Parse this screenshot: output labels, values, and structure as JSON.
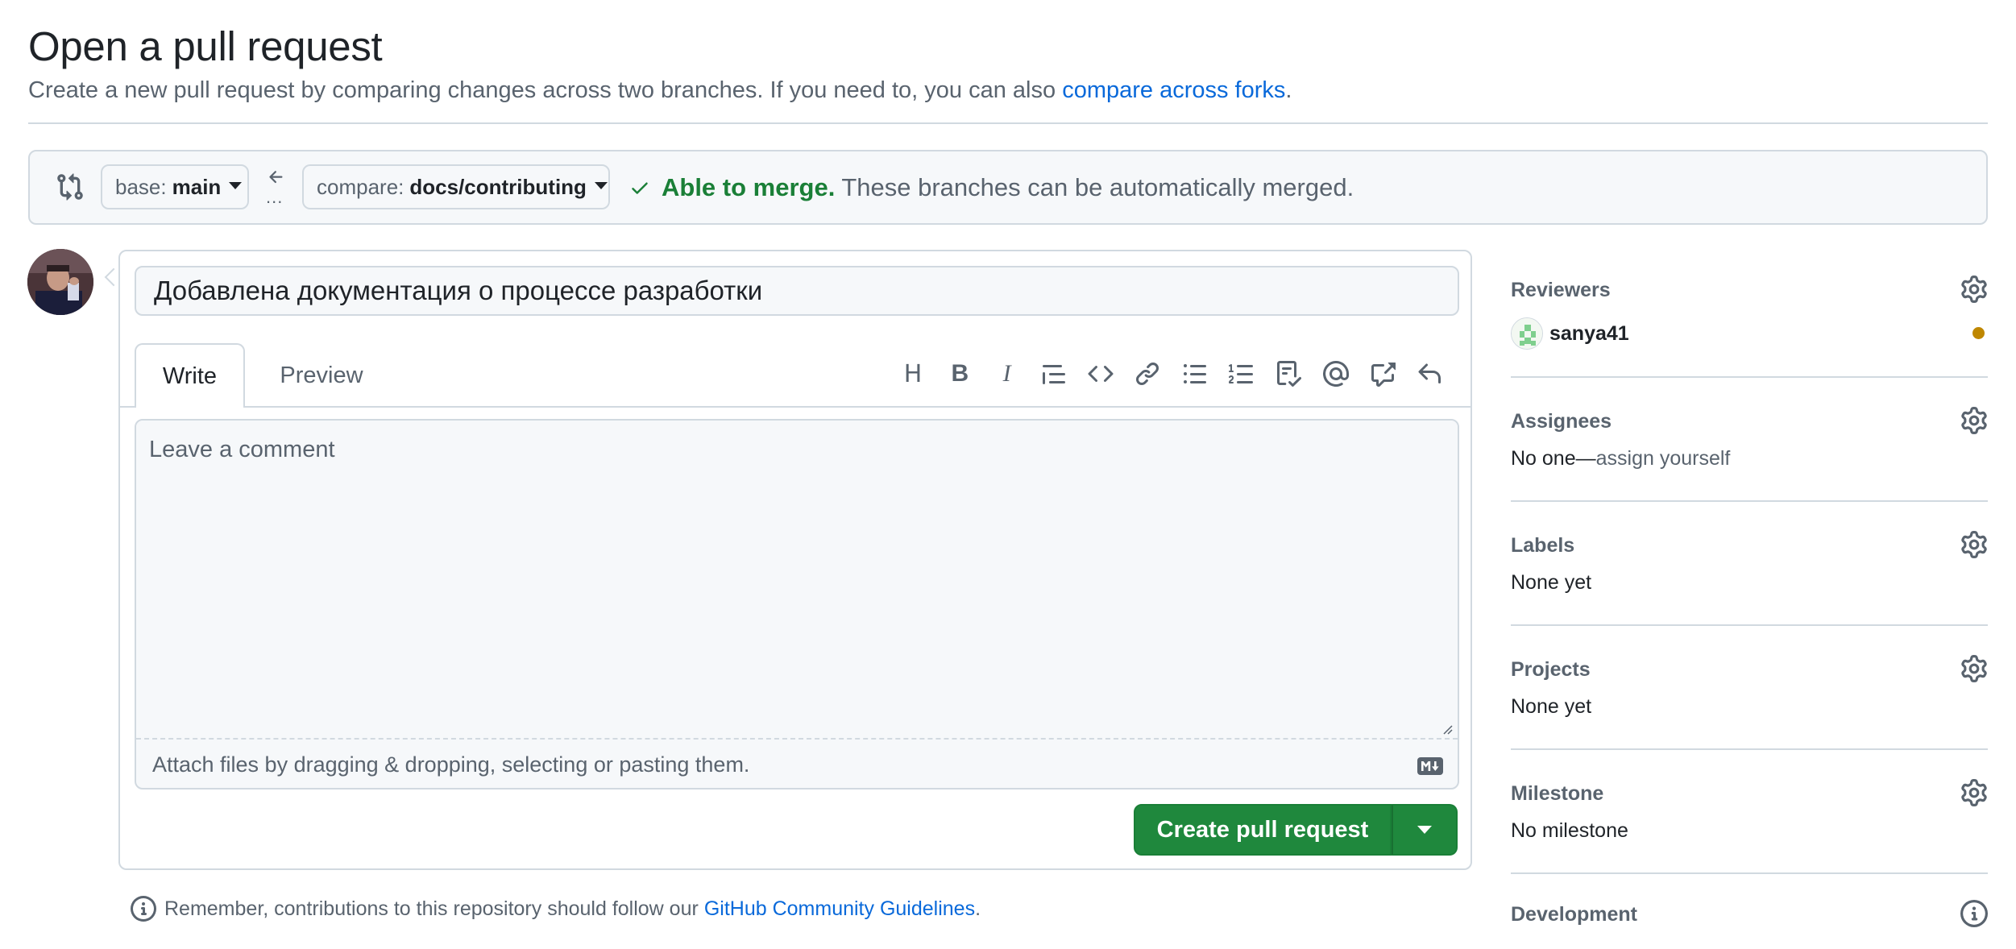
{
  "header": {
    "title": "Open a pull request",
    "subtitle": "Create a new pull request by comparing changes across two branches. If you need to, you can also",
    "subtitle_link": "compare across forks",
    "subtitle_end": "."
  },
  "range": {
    "base_label": "base:",
    "base_branch": "main",
    "arrow_dots": "...",
    "compare_label": "compare:",
    "compare_branch": "docs/contributing",
    "merge_ok": "Able to merge.",
    "merge_text": "These branches can be automatically merged."
  },
  "composer": {
    "title_value": "Добавлена документация о процессе разработки",
    "tabs": {
      "write": "Write",
      "preview": "Preview"
    },
    "toolbar": {
      "heading": "H",
      "bold": "B",
      "italic": "I"
    },
    "comment_placeholder": "Leave a comment",
    "attach_text": "Attach files by dragging & dropping, selecting or pasting them.",
    "create_label": "Create pull request"
  },
  "guideline": {
    "text": "Remember, contributions to this repository should follow our",
    "link": "GitHub Community Guidelines",
    "end": "."
  },
  "sidebar": {
    "reviewers": {
      "heading": "Reviewers",
      "user": "sanya41",
      "pending_color": "#bf8700"
    },
    "assignees": {
      "heading": "Assignees",
      "value": "No one—",
      "link": "assign yourself"
    },
    "labels": {
      "heading": "Labels",
      "value": "None yet"
    },
    "projects": {
      "heading": "Projects",
      "value": "None yet"
    },
    "milestone": {
      "heading": "Milestone",
      "value": "No milestone"
    },
    "development": {
      "heading": "Development"
    }
  },
  "colors": {
    "accent_link": "#0969da",
    "success": "#1a7f37",
    "button_green": "#1f883d",
    "border": "#d1d9e0"
  }
}
